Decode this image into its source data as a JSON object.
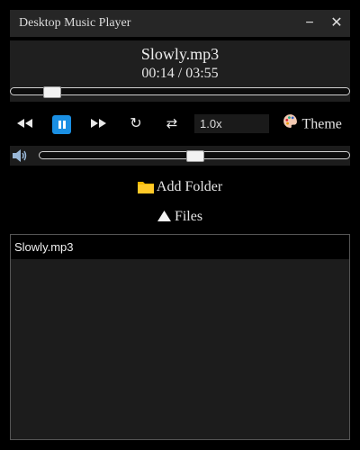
{
  "window": {
    "title": "Desktop Music Player",
    "minimize_glyph": "−",
    "close_glyph": "✕"
  },
  "now_playing": {
    "song": "Slowly.mp3",
    "elapsed": "00:14",
    "duration": "03:55",
    "time_display": "00:14 / 03:55",
    "progress_fraction": 0.06
  },
  "controls": {
    "rewind_icon": "rewind-icon",
    "pause_icon": "pause-icon",
    "forward_icon": "fast-forward-icon",
    "repeat_icon": "repeat-icon",
    "shuffle_icon": "shuffle-icon",
    "speed_value": "1.0x",
    "theme_label": "Theme",
    "accent_color": "#1a8fe3"
  },
  "volume": {
    "icon": "speaker-icon",
    "level_fraction": 0.5
  },
  "actions": {
    "add_folder_label": "Add Folder",
    "files_label": "Files"
  },
  "playlist": {
    "items": [
      "Slowly.mp3"
    ]
  }
}
